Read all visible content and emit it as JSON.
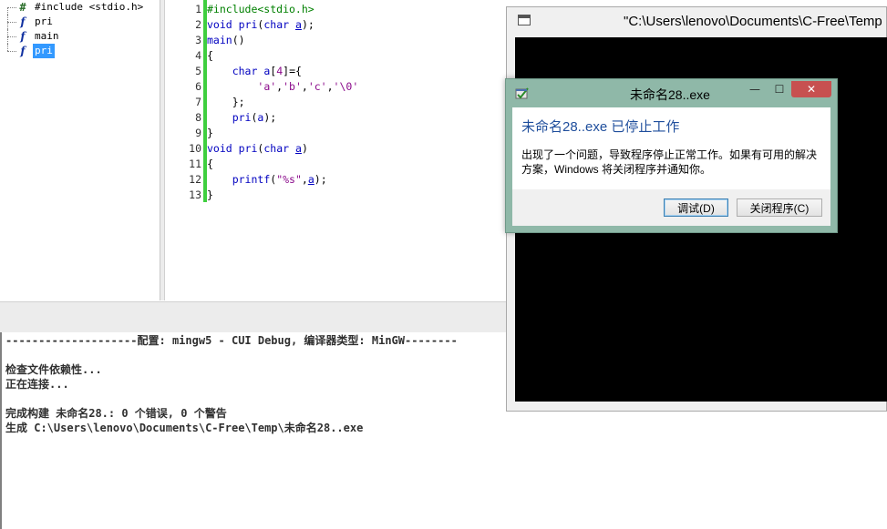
{
  "tree": {
    "items": [
      {
        "icon": "#",
        "label": "#include <stdio.h>",
        "selected": false
      },
      {
        "icon": "f",
        "label": "pri",
        "selected": false
      },
      {
        "icon": "f",
        "label": "main",
        "selected": false
      },
      {
        "icon": "f",
        "label": "pri",
        "selected": true
      }
    ]
  },
  "editor": {
    "line_numbers": [
      "1",
      "2",
      "3",
      "4",
      "5",
      "6",
      "7",
      "8",
      "9",
      "10",
      "11",
      "12",
      "13"
    ]
  },
  "output": {
    "lines": [
      "--------------------配置: mingw5 - CUI Debug, 编译器类型: MinGW--------",
      "",
      "检查文件依赖性...",
      "正在连接...",
      "",
      "完成构建 未命名28.: 0 个错误, 0 个警告",
      "生成 C:\\Users\\lenovo\\Documents\\C-Free\\Temp\\未命名28..exe"
    ]
  },
  "console": {
    "title": "\"C:\\Users\\lenovo\\Documents\\C-Free\\Temp"
  },
  "dialog": {
    "title": "未命名28..exe",
    "min_glyph": "—",
    "max_glyph": "☐",
    "close_glyph": "✕",
    "heading": "未命名28..exe 已停止工作",
    "message": "出现了一个问题，导致程序停止正常工作。如果有可用的解决方案，Windows 将关闭程序并通知你。",
    "debug_label": "调试(D)",
    "close_program_label": "关闭程序(C)"
  }
}
